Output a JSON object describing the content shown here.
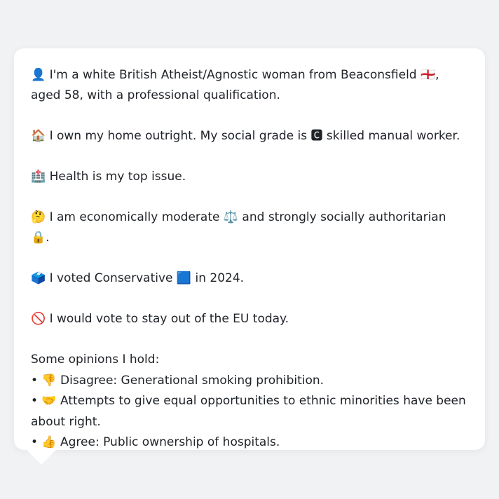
{
  "profile": {
    "identity": "👤 I'm a white British Atheist/Agnostic woman from Beaconsfield 🏴󠁧󠁢󠁥󠁮󠁧󠁿, aged 58, with a professional qualification.",
    "home": "🏠 I own my home outright. My social grade is 🅲 skilled manual worker.",
    "issue": "🏥 Health is my top issue.",
    "politics": "🤔 I am economically moderate ⚖️ and strongly socially authoritarian 🔒.",
    "vote": "🗳️ I voted Conservative 🟦 in 2024.",
    "eu": "🚫 I would vote to stay out of the EU today."
  },
  "opinions": {
    "heading": "Some opinions I hold:",
    "items": [
      "• 👎 Disagree: Generational smoking prohibition.",
      "• 🤝 Attempts to give equal opportunities to ethnic minorities have been about right.",
      "• 👍 Agree: Public ownership of hospitals."
    ]
  }
}
